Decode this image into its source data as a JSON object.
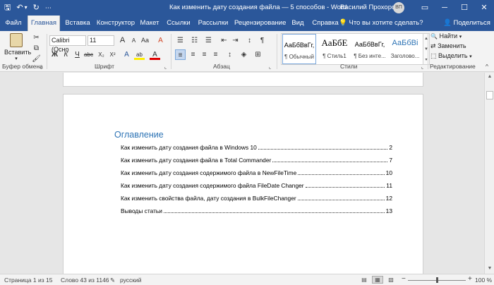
{
  "titlebar": {
    "qat": {
      "save": "🖫",
      "undo": "↶",
      "undo_dropdown": "▾",
      "redo": "↻",
      "customize": "⋯"
    },
    "title": "Как изменить дату создания файла — 5 способов  -  Word",
    "user": "Василий Прохоров",
    "avatar_initials": "ВП",
    "ribbon_options": "▭",
    "minimize": "─",
    "maximize": "☐",
    "close": "✕"
  },
  "tabs": [
    {
      "label": "Файл"
    },
    {
      "label": "Главная"
    },
    {
      "label": "Вставка"
    },
    {
      "label": "Конструктор"
    },
    {
      "label": "Макет"
    },
    {
      "label": "Ссылки"
    },
    {
      "label": "Рассылки"
    },
    {
      "label": "Рецензирование"
    },
    {
      "label": "Вид"
    },
    {
      "label": "Справка"
    }
  ],
  "tell_me": {
    "icon": "💡",
    "text": "Что вы хотите сделать?"
  },
  "share": {
    "icon": "👤",
    "text": "Поделиться"
  },
  "ribbon": {
    "clipboard": {
      "paste_label": "Вставить",
      "paste_arrow": "▾",
      "cut": "✂",
      "copy": "⧉",
      "format_painter": "🖌",
      "group_label": "Буфер обмена",
      "launcher": "⌞"
    },
    "font": {
      "font_name": "Calibri (Осно",
      "font_size": "11",
      "grow": "A",
      "shrink": "A",
      "case": "Aa",
      "clear": "A",
      "bold": "Ж",
      "italic": "К",
      "underline": "Ч",
      "strike": "abc",
      "subscript": "X₂",
      "superscript": "X²",
      "effects": "A",
      "highlight": "ab",
      "color": "A",
      "group_label": "Шрифт",
      "launcher": "⌞"
    },
    "paragraph": {
      "bullets": "☰",
      "numbering": "☷",
      "multilevel": "☰",
      "decrease_indent": "⇤",
      "increase_indent": "⇥",
      "sort": "↕",
      "pilcrow": "¶",
      "align_left": "≡",
      "align_center": "≡",
      "align_right": "≡",
      "justify": "≡",
      "line_spacing": "↕",
      "shading": "◈",
      "borders": "⊞",
      "group_label": "Абзац",
      "launcher": "⌞"
    },
    "styles": {
      "items": [
        {
          "sample": "АаБбВвГг,",
          "name": "¶ Обычный"
        },
        {
          "sample": "АаБбЕ",
          "name": "¶ Стиль1"
        },
        {
          "sample": "АаБбВвГг,",
          "name": "¶ Без инте..."
        },
        {
          "sample": "АаБбВі",
          "name": "Заголово..."
        }
      ],
      "scroll_up": "▲",
      "scroll_down": "▼",
      "more": "▾",
      "group_label": "Стили",
      "launcher": "⌞"
    },
    "editing": {
      "find_icon": "🔍",
      "find": "Найти",
      "find_arrow": "▾",
      "replace_icon": "⇄",
      "replace": "Заменить",
      "select_icon": "⬚",
      "select": "Выделить",
      "select_arrow": "▾",
      "group_label": "Редактирование",
      "collapse": "^"
    }
  },
  "document": {
    "toc_title": "Оглавление",
    "toc": [
      {
        "text": "Как изменить дату создания файла в Windows 10",
        "page": "2"
      },
      {
        "text": "Как изменить дату создания файла в Total Commander",
        "page": "7"
      },
      {
        "text": "Как изменить дату создания содержимого файла в NewFileTime",
        "page": "10"
      },
      {
        "text": "Как изменить дату создания содержимого файла FileDate Changer",
        "page": "11"
      },
      {
        "text": "Как изменить свойства файла, дату создания в BulkFileChanger",
        "page": "12"
      },
      {
        "text": "Выводы статьи",
        "page": "13"
      }
    ]
  },
  "scrollbar": {
    "up": "▲",
    "down": "▼"
  },
  "statusbar": {
    "page": "Страница 1 из 15",
    "words": "Слово 43 из 1146",
    "proofing_icon": "✎",
    "language": "русский",
    "view_read": "▤",
    "view_print": "▦",
    "view_web": "▧",
    "zoom_out": "−",
    "zoom_in": "+",
    "zoom": "100 %",
    "zoom_level_percent": 100
  }
}
